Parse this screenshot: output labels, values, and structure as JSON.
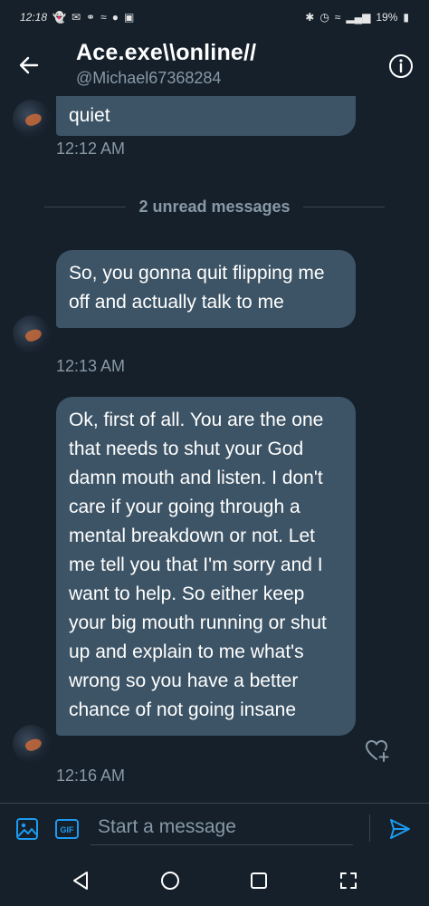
{
  "status_bar": {
    "time": "12:18",
    "battery": "19%"
  },
  "header": {
    "title": "Ace.exe\\\\online//",
    "handle": "@Michael67368284"
  },
  "messages": [
    {
      "text": "quiet",
      "time": "12:12 AM"
    },
    {
      "text": "So, you gonna quit flipping me off and actually talk to me",
      "time": "12:13 AM"
    },
    {
      "text": "Ok, first of all. You are the one that needs to shut your God damn mouth and listen. I don't care if your going through a mental breakdown or not. Let me tell you that I'm sorry and I want to help. So either keep your big mouth running or shut up and explain to me what's wrong so you have a better chance of not going insane",
      "time": "12:16 AM"
    }
  ],
  "divider": {
    "label": "2 unread messages"
  },
  "compose": {
    "placeholder": "Start a message",
    "gif_label": "GIF"
  },
  "colors": {
    "background": "#15202b",
    "bubble": "#3d5466",
    "accent": "#1d9bf0",
    "muted": "#8899a6"
  },
  "icons": {
    "back": "arrow-left-icon",
    "info": "info-icon",
    "image": "image-icon",
    "gif": "gif-icon",
    "send": "send-icon",
    "heart": "heart-plus-icon"
  }
}
